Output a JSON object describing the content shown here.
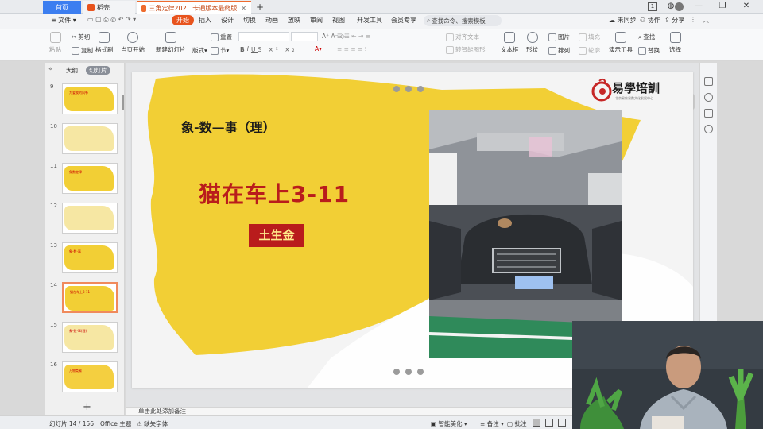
{
  "tabs": {
    "home": "首页",
    "daoke": "稻壳",
    "document": "三角定律202...卡通版本最终版",
    "plus": "+"
  },
  "window": {
    "counter": "1",
    "minimize": "—",
    "restore": "❐",
    "close": "✕"
  },
  "ribbon_tabs": {
    "file": "文件",
    "start": "开始",
    "insert": "插入",
    "design": "设计",
    "transition": "切换",
    "animation": "动画",
    "slideshow": "放映",
    "review": "审阅",
    "view": "视图",
    "devtools": "开发工具",
    "member": "会员专享",
    "search": "查找命令、搜索模板",
    "unsynced": "未同步",
    "collab": "协作",
    "share": "分享"
  },
  "toolbar": {
    "paste": "粘贴",
    "cut": "剪切",
    "copy": "复制",
    "format_painter": "格式刷",
    "play_from_current": "当页开始",
    "new_slide": "新建幻灯片",
    "layout": "版式",
    "section": "节",
    "reset": "重置",
    "text_direction": "对齐文本",
    "convert_smartart": "转智能图形",
    "textbox": "文本框",
    "shape": "形状",
    "picture": "图片",
    "fill": "填充",
    "arrange": "排列",
    "outline": "轮廓",
    "presentation_tools": "演示工具",
    "find": "查找",
    "replace": "替换",
    "select": "选择"
  },
  "left_panel": {
    "outline_tab": "大纲",
    "slides_tab": "幻灯片",
    "add": "+",
    "thumbnails": [
      {
        "num": "9",
        "title": "为爱我的风筝"
      },
      {
        "num": "10",
        "title": ""
      },
      {
        "num": "11",
        "title": "象数定律一"
      },
      {
        "num": "12",
        "title": ""
      },
      {
        "num": "13",
        "title": "象-数-事"
      },
      {
        "num": "14",
        "title": "猫在车上3-11"
      },
      {
        "num": "15",
        "title": "象-数-事(理)"
      },
      {
        "num": "16",
        "title": "万物类象"
      }
    ]
  },
  "slide": {
    "title": "象-数—事（理）",
    "heading": "猫在车上3-11",
    "badge": "土生金",
    "logo_text": "易學培訓",
    "logo_sub": "北京易象易数文化发展中心"
  },
  "notes": {
    "placeholder": "单击此处添加备注"
  },
  "status": {
    "slide_counter": "幻灯片 14 / 156",
    "theme": "Office 主题",
    "missing_font": "缺失字体",
    "smart_beautify": "智能美化",
    "notes": "备注",
    "comments": "批注"
  },
  "colors": {
    "accent_orange": "#e8541e",
    "slide_yellow": "#f2cf35",
    "heading_red": "#b91c1c",
    "home_blue": "#3c7ef0"
  }
}
